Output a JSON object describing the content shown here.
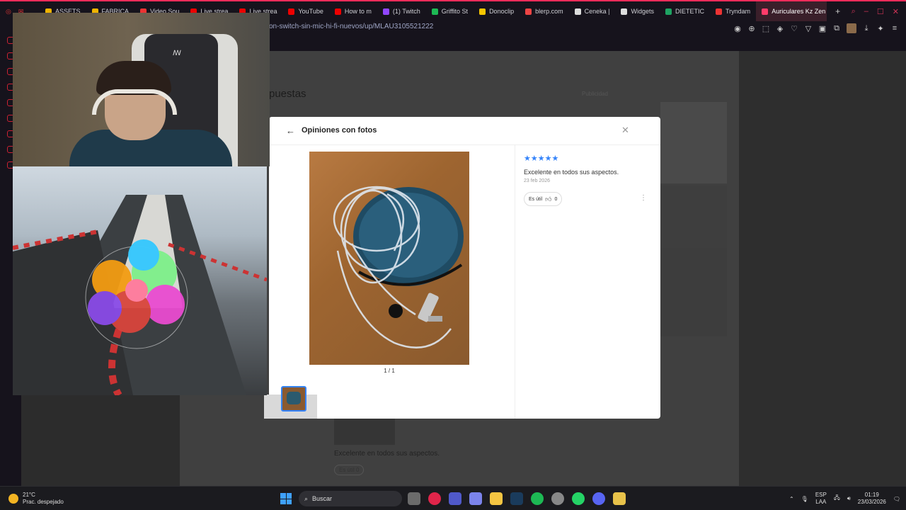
{
  "browser": {
    "tabs": [
      {
        "label": "ASSETS",
        "color": "#f0b400"
      },
      {
        "label": "FABRICA",
        "color": "#f0b400"
      },
      {
        "label": "Video Sou",
        "color": "#e33"
      },
      {
        "label": "Live strea",
        "color": "#e00"
      },
      {
        "label": "Live strea",
        "color": "#e00"
      },
      {
        "label": "YouTube",
        "color": "#e00"
      },
      {
        "label": "How to m",
        "color": "#e00"
      },
      {
        "label": "(1) Twitch",
        "color": "#9146ff"
      },
      {
        "label": "Griffito St",
        "color": "#1db954"
      },
      {
        "label": "Donoclip",
        "color": "#f7c600"
      },
      {
        "label": "blerp.com",
        "color": "#e44"
      },
      {
        "label": "Ceneka |",
        "color": "#ddd"
      },
      {
        "label": "Widgets",
        "color": "#ddd"
      },
      {
        "label": "DIETETIC",
        "color": "#1ea362"
      },
      {
        "label": "Tryndam",
        "color": "#e33"
      },
      {
        "label": "Auriculares Kz Zen",
        "color": "#ff3c6a",
        "active": true
      }
    ],
    "url": "on-switch-sin-mic-hi-fi-nuevos/up/MLAU3105521222"
  },
  "background_page": {
    "heading": "puestas",
    "publicidad": "Publicidad",
    "review_text": "Excelente en todos sus aspectos.",
    "util_label": "Es útil 0"
  },
  "modal": {
    "title": "Opiniones con fotos",
    "counter": "1 / 1",
    "stars": "★★★★★",
    "review_text": "Excelente en todos sus aspectos.",
    "date": "23 feb 2026",
    "util_label": "Es útil",
    "util_count": "0"
  },
  "taskbar": {
    "temp": "21°C",
    "weather": "Prac. despejado",
    "search_placeholder": "Buscar",
    "lang1": "ESP",
    "lang2": "LAA",
    "time": "01:19",
    "date": "23/03/2026"
  }
}
